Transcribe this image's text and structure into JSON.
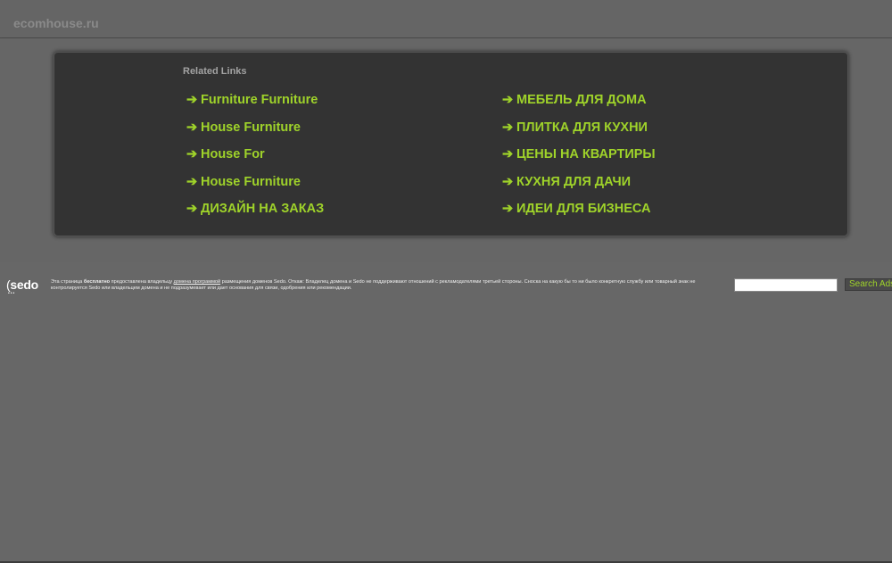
{
  "header": {
    "domain": "ecomhouse.ru"
  },
  "related": {
    "title": "Related Links",
    "arrow": "➔",
    "left": [
      {
        "label": "Furniture Furniture"
      },
      {
        "label": "House Furniture"
      },
      {
        "label": "House For"
      },
      {
        "label": "House Furniture"
      },
      {
        "label": "ДИЗАЙН НА ЗАКАЗ"
      }
    ],
    "right": [
      {
        "label": "МЕБЕЛЬ ДЛЯ ДОМА"
      },
      {
        "label": "ПЛИТКА ДЛЯ КУХНИ"
      },
      {
        "label": "ЦЕНЫ НА КВАРТИРЫ"
      },
      {
        "label": "КУХНЯ ДЛЯ ДАЧИ"
      },
      {
        "label": "ИДЕИ ДЛЯ БИЗНЕСА"
      }
    ]
  },
  "footer": {
    "logo": "sedo",
    "disclaimer_part1": "Эта страница ",
    "disclaimer_bold": "бесплатно",
    "disclaimer_part2": " предоставлена владельцу ",
    "disclaimer_link": "домена программой",
    "disclaimer_part3": " размещения доменов Sedo. Откаж: Владелец домена и Sedo не поддерживают отношений с рекламодателями третьей стороны. Сноска на какую бы то ни было конкретную службу или товарный знак не контролируется Sedo или владельцем домена и не подразумевает или дает основания для связи, одобрения или рекомендации.",
    "search_value": "",
    "search_button": "Search Ads"
  },
  "colors": {
    "background": "#676767",
    "panel": "#333333",
    "link": "#9fd32a"
  }
}
